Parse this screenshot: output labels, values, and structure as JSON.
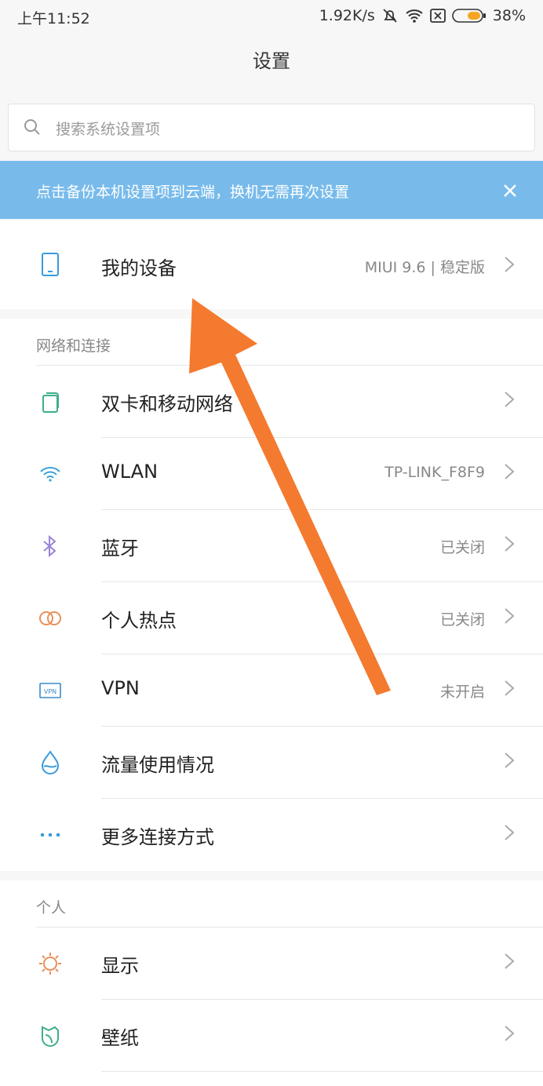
{
  "status": {
    "time": "上午11:52",
    "speed": "1.92K/s",
    "battery": "38%"
  },
  "header": {
    "title": "设置"
  },
  "search": {
    "placeholder": "搜索系统设置项"
  },
  "banner": {
    "text": "点击备份本机设置项到云端，换机无需再次设置"
  },
  "device": {
    "label": "我的设备",
    "value": "MIUI 9.6 | 稳定版"
  },
  "network": {
    "title": "网络和连接",
    "items": [
      {
        "label": "双卡和移动网络",
        "value": "",
        "icon": "sim-card-icon"
      },
      {
        "label": "WLAN",
        "value": "TP-LINK_F8F9",
        "icon": "wifi-icon"
      },
      {
        "label": "蓝牙",
        "value": "已关闭",
        "icon": "bluetooth-icon"
      },
      {
        "label": "个人热点",
        "value": "已关闭",
        "icon": "hotspot-icon"
      },
      {
        "label": "VPN",
        "value": "未开启",
        "icon": "vpn-icon"
      },
      {
        "label": "流量使用情况",
        "value": "",
        "icon": "data-usage-icon"
      },
      {
        "label": "更多连接方式",
        "value": "",
        "icon": "more-dots-icon"
      }
    ]
  },
  "personal": {
    "title": "个人",
    "items": [
      {
        "label": "显示",
        "icon": "display-sun-icon"
      },
      {
        "label": "壁纸",
        "icon": "wallpaper-icon"
      }
    ]
  },
  "colors": {
    "accent": "#3a9bdc",
    "banner": "#78bbeb",
    "arrow": "#f47a2f"
  }
}
